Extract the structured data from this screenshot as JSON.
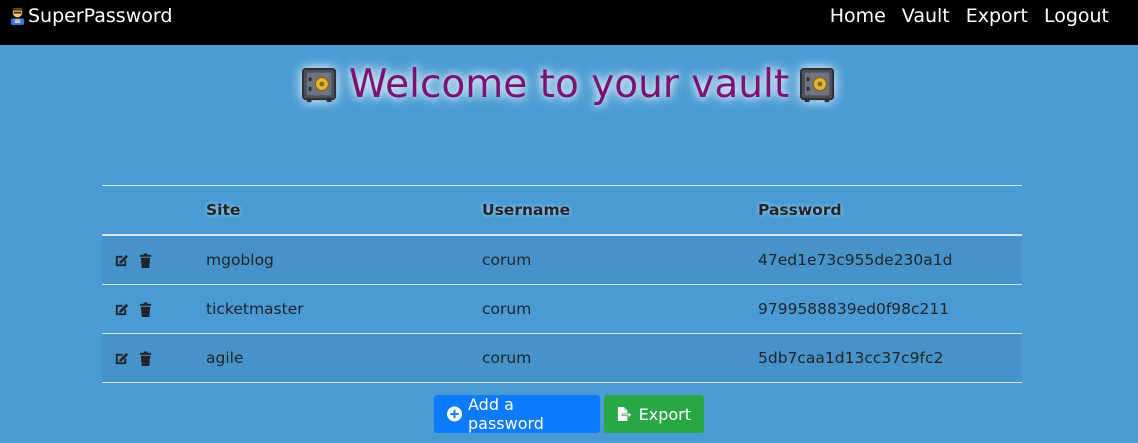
{
  "navbar": {
    "brand": "SuperPassword",
    "brand_icon": "technologist-emoji-icon",
    "links": [
      {
        "label": "Home"
      },
      {
        "label": "Vault"
      },
      {
        "label": "Export"
      },
      {
        "label": "Logout"
      }
    ]
  },
  "page": {
    "title": "Welcome to your vault",
    "title_icon": "safe-icon",
    "title_color": "#7b1373",
    "background": "#4a9bd4"
  },
  "table": {
    "headers": [
      "",
      "Site",
      "Username",
      "Password"
    ],
    "rows": [
      {
        "site": "mgoblog",
        "username": "corum",
        "password": "47ed1e73c955de230a1d"
      },
      {
        "site": "ticketmaster",
        "username": "corum",
        "password": "9799588839ed0f98c211"
      },
      {
        "site": "agile",
        "username": "corum",
        "password": "5db7caa1d13cc37c9fc2"
      }
    ],
    "row_actions": [
      "edit-icon",
      "trash-icon"
    ]
  },
  "buttons": {
    "add_label": "Add a password",
    "add_icon": "plus-circle-icon",
    "add_color": "#0d7bfd",
    "export_label": "Export",
    "export_icon": "file-export-icon",
    "export_color": "#28a745"
  }
}
